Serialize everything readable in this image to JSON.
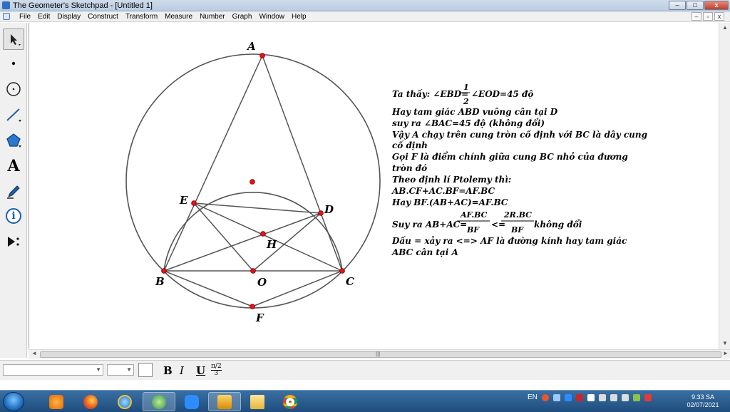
{
  "window": {
    "title": "The Geometer's Sketchpad - [Untitled 1]",
    "minimize": "–",
    "maximize": "□",
    "close": "x"
  },
  "menubar": {
    "items": [
      "File",
      "Edit",
      "Display",
      "Construct",
      "Transform",
      "Measure",
      "Number",
      "Graph",
      "Window",
      "Help"
    ],
    "doc_minimize": "–",
    "doc_restore": "▫",
    "doc_close": "x"
  },
  "toolbox": {
    "tools": [
      {
        "name": "arrow-select-tool",
        "icon": "arrow-icon"
      },
      {
        "name": "point-tool",
        "icon": "point-icon"
      },
      {
        "name": "compass-tool",
        "icon": "compass-circle-icon"
      },
      {
        "name": "straightedge-tool",
        "icon": "segment-icon"
      },
      {
        "name": "polygon-tool",
        "icon": "polygon-icon"
      },
      {
        "name": "text-tool",
        "icon": "text-a-icon",
        "glyph": "A"
      },
      {
        "name": "marker-tool",
        "icon": "marker-pen-icon"
      },
      {
        "name": "information-tool",
        "icon": "info-icon",
        "glyph": "i"
      },
      {
        "name": "custom-tool",
        "icon": "play-custom-icon"
      }
    ]
  },
  "figure": {
    "labels": {
      "A": "A",
      "B": "B",
      "C": "C",
      "D": "D",
      "E": "E",
      "F": "F",
      "H": "H",
      "O": "O"
    },
    "colors": {
      "line": "#555555",
      "point": "#e8101a",
      "point_stroke": "#7a0000"
    }
  },
  "notes": {
    "line1": {
      "before": "Ta thấy: ∠EBD=",
      "frac_num": "1",
      "frac_den": "2",
      "after": "∠EOD=45 độ"
    },
    "lines": [
      "Hay tam giác ABD vuông cân tại D",
      "suy ra ∠BAC=45 độ (không đổi)",
      "Vậy A chạy trên cung tròn cố định với BC là dây cung",
      "cố định",
      "Gọi F là điểm chính giữa cung BC nhỏ của đương",
      "tròn đó",
      "Theo định lí Ptolemy thì:",
      "AB.CF+AC.BF=AF.BC",
      "Hay BF.(AB+AC)=AF.BC"
    ],
    "suy_ra": {
      "before": "Suy ra AB+AC=",
      "frac1_num": "AF.BC",
      "frac1_den": "BF",
      "middle": "<=",
      "frac2_num": "2R.BC",
      "frac2_den": "BF",
      "after": "không đổi"
    },
    "last_lines": [
      "Dấu = xảy ra <=> AF là đường kính hay tam giác",
      "ABC cân tại A"
    ]
  },
  "scrollbar": {
    "grip": "|||"
  },
  "formatbar": {
    "bold": "B",
    "italic": "I",
    "underline": "U",
    "math_top": "π/2",
    "math_bottom": "3"
  },
  "taskbar": {
    "apps": [
      "windows-media-player",
      "firefox",
      "internet-explorer",
      "coccoc",
      "zoom",
      "sketchpad",
      "file-explorer",
      "chrome"
    ],
    "language": "EN",
    "time": "9:33 SA",
    "date": "02/07/2021"
  }
}
